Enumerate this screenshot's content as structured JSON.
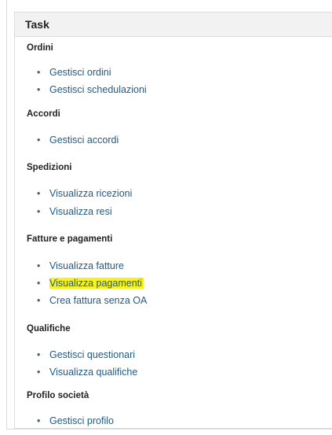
{
  "panel": {
    "title": "Task",
    "sections": [
      {
        "title": "Ordini",
        "links": [
          {
            "label": "Gestisci ordini",
            "highlighted": false
          },
          {
            "label": "Gestisci schedulazioni",
            "highlighted": false
          }
        ]
      },
      {
        "title": "Accordi",
        "links": [
          {
            "label": "Gestisci accordi",
            "highlighted": false
          }
        ]
      },
      {
        "title": "Spedizioni",
        "links": [
          {
            "label": "Visualizza ricezioni",
            "highlighted": false
          },
          {
            "label": "Visualizza resi",
            "highlighted": false
          }
        ]
      },
      {
        "title": "Fatture e pagamenti",
        "links": [
          {
            "label": "Visualizza fatture",
            "highlighted": false
          },
          {
            "label": "Visualizza pagamenti",
            "highlighted": true
          },
          {
            "label": "Crea fattura senza OA",
            "highlighted": false
          }
        ]
      },
      {
        "title": "Qualifiche",
        "links": [
          {
            "label": "Gestisci questionari",
            "highlighted": false
          },
          {
            "label": "Visualizza qualifiche",
            "highlighted": false
          }
        ]
      },
      {
        "title": "Profilo società",
        "links": [
          {
            "label": "Gestisci profilo",
            "highlighted": false
          }
        ]
      }
    ]
  },
  "colors": {
    "link": "#235a82",
    "highlight": "#f7f21a",
    "header_bg": "#f2f2f2"
  }
}
